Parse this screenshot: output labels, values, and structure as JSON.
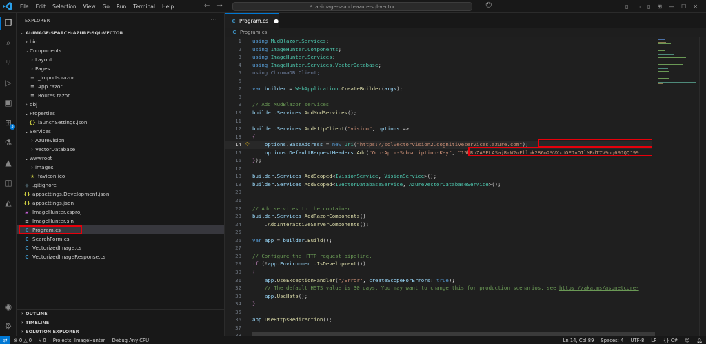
{
  "menu": [
    "File",
    "Edit",
    "Selection",
    "View",
    "Go",
    "Run",
    "Terminal",
    "Help"
  ],
  "search": {
    "text": "ai-image-search-azure-sql-vector"
  },
  "sidebar": {
    "title": "EXPLORER",
    "root": "AI-IMAGE-SEARCH-AZURE-SQL-VECTOR",
    "tree": [
      {
        "label": "bin",
        "type": "folder",
        "open": false,
        "depth": 1
      },
      {
        "label": "Components",
        "type": "folder",
        "open": true,
        "depth": 1
      },
      {
        "label": "Layout",
        "type": "folder",
        "open": false,
        "depth": 2
      },
      {
        "label": "Pages",
        "type": "folder",
        "open": false,
        "depth": 2
      },
      {
        "label": "_Imports.razor",
        "type": "razor",
        "depth": 2
      },
      {
        "label": "App.razor",
        "type": "razor",
        "depth": 2
      },
      {
        "label": "Routes.razor",
        "type": "razor",
        "depth": 2
      },
      {
        "label": "obj",
        "type": "folder",
        "open": false,
        "depth": 1
      },
      {
        "label": "Properties",
        "type": "folder",
        "open": true,
        "depth": 1
      },
      {
        "label": "launchSettings.json",
        "type": "json",
        "depth": 2
      },
      {
        "label": "Services",
        "type": "folder",
        "open": true,
        "depth": 1
      },
      {
        "label": "AzureVision",
        "type": "folder",
        "open": false,
        "depth": 2
      },
      {
        "label": "VectorDatabase",
        "type": "folder",
        "open": false,
        "depth": 2
      },
      {
        "label": "wwwroot",
        "type": "folder",
        "open": true,
        "depth": 1
      },
      {
        "label": "images",
        "type": "folder",
        "open": false,
        "depth": 2
      },
      {
        "label": "favicon.ico",
        "type": "ico",
        "depth": 2
      },
      {
        "label": ".gitignore",
        "type": "git",
        "depth": 1
      },
      {
        "label": "appsettings.Development.json",
        "type": "json",
        "depth": 1
      },
      {
        "label": "appsettings.json",
        "type": "json",
        "depth": 1
      },
      {
        "label": "ImageHunter.csproj",
        "type": "proj",
        "depth": 1
      },
      {
        "label": "ImageHunter.sln",
        "type": "sln",
        "depth": 1
      },
      {
        "label": "Program.cs",
        "type": "cs",
        "depth": 1,
        "selected": true
      },
      {
        "label": "SearchForm.cs",
        "type": "cs",
        "depth": 1
      },
      {
        "label": "VectorizedImage.cs",
        "type": "cs",
        "depth": 1
      },
      {
        "label": "VectorizedImageResponse.cs",
        "type": "cs",
        "depth": 1
      }
    ],
    "bottom_sections": [
      "OUTLINE",
      "TIMELINE",
      "SOLUTION EXPLORER"
    ]
  },
  "editor": {
    "tab_label": "Program.cs",
    "breadcrumb": "Program.cs",
    "current_line": 14,
    "lines": [
      [
        [
          "kw",
          "using "
        ],
        [
          "ns",
          "MudBlazor.Services"
        ],
        [
          "pl",
          ";"
        ]
      ],
      [
        [
          "kw",
          "using "
        ],
        [
          "ns",
          "ImageHunter.Components"
        ],
        [
          "pl",
          ";"
        ]
      ],
      [
        [
          "kw",
          "using "
        ],
        [
          "ns",
          "ImageHunter.Services"
        ],
        [
          "pl",
          ";"
        ]
      ],
      [
        [
          "kw",
          "using "
        ],
        [
          "ns",
          "ImageHunter.Services.VectorDatabase"
        ],
        [
          "pl",
          ";"
        ]
      ],
      [
        [
          "dim",
          "using ChromaDB.Client;"
        ]
      ],
      [],
      [
        [
          "kw",
          "var "
        ],
        [
          "id",
          "builder"
        ],
        [
          "pl",
          " = "
        ],
        [
          "cl",
          "WebApplication"
        ],
        [
          "pl",
          "."
        ],
        [
          "fn",
          "CreateBuilder"
        ],
        [
          "pl",
          "("
        ],
        [
          "id",
          "args"
        ],
        [
          "pl",
          ");"
        ]
      ],
      [],
      [
        [
          "cm",
          "// Add MudBlazor services"
        ]
      ],
      [
        [
          "id",
          "builder"
        ],
        [
          "pl",
          "."
        ],
        [
          "id",
          "Services"
        ],
        [
          "pl",
          "."
        ],
        [
          "fn",
          "AddMudServices"
        ],
        [
          "pl",
          "();"
        ]
      ],
      [],
      [
        [
          "id",
          "builder"
        ],
        [
          "pl",
          "."
        ],
        [
          "id",
          "Services"
        ],
        [
          "pl",
          "."
        ],
        [
          "fn",
          "AddHttpClient"
        ],
        [
          "pl",
          "("
        ],
        [
          "str",
          "\"vision\""
        ],
        [
          "pl",
          ", "
        ],
        [
          "id",
          "options"
        ],
        [
          "pl",
          " =>"
        ]
      ],
      [
        [
          "ctl",
          "{"
        ]
      ],
      [
        [
          "pl",
          "    "
        ],
        [
          "id",
          "options"
        ],
        [
          "pl",
          "."
        ],
        [
          "id",
          "BaseAddress"
        ],
        [
          "pl",
          " = "
        ],
        [
          "kw",
          "new "
        ],
        [
          "cl",
          "Uri"
        ],
        [
          "pl",
          "("
        ],
        [
          "str",
          "\"https://sqlvectorvision2.cognitiveservices.azure.com\""
        ],
        [
          "pl",
          ");"
        ]
      ],
      [
        [
          "pl",
          "    "
        ],
        [
          "id",
          "options"
        ],
        [
          "pl",
          "."
        ],
        [
          "id",
          "DefaultRequestHeaders"
        ],
        [
          "pl",
          "."
        ],
        [
          "fn",
          "Add"
        ],
        [
          "pl",
          "("
        ],
        [
          "str",
          "\"Ocp-Apim-Subscription-Key\""
        ],
        [
          "pl",
          ", "
        ],
        [
          "str",
          "\"15hRuZASELASajRrW2nFllok286m29VXxUOFJnO1lMRdT7V9og69JQQJ99"
        ]
      ],
      [
        [
          "ctl",
          "}"
        ],
        [
          "pl",
          ");"
        ]
      ],
      [],
      [
        [
          "id",
          "builder"
        ],
        [
          "pl",
          "."
        ],
        [
          "id",
          "Services"
        ],
        [
          "pl",
          "."
        ],
        [
          "fn",
          "AddScoped"
        ],
        [
          "pl",
          "<"
        ],
        [
          "cl",
          "IVisionService"
        ],
        [
          "pl",
          ", "
        ],
        [
          "cl",
          "VisionService"
        ],
        [
          "pl",
          ">();"
        ]
      ],
      [
        [
          "id",
          "builder"
        ],
        [
          "pl",
          "."
        ],
        [
          "id",
          "Services"
        ],
        [
          "pl",
          "."
        ],
        [
          "fn",
          "AddScoped"
        ],
        [
          "pl",
          "<"
        ],
        [
          "cl",
          "IVectorDatabaseService"
        ],
        [
          "pl",
          ", "
        ],
        [
          "cl",
          "AzureVectorDatabaseService"
        ],
        [
          "pl",
          ">();"
        ]
      ],
      [],
      [],
      [
        [
          "cm",
          "// Add services to the container."
        ]
      ],
      [
        [
          "id",
          "builder"
        ],
        [
          "pl",
          "."
        ],
        [
          "id",
          "Services"
        ],
        [
          "pl",
          "."
        ],
        [
          "fn",
          "AddRazorComponents"
        ],
        [
          "pl",
          "()"
        ]
      ],
      [
        [
          "pl",
          "    ."
        ],
        [
          "fn",
          "AddInteractiveServerComponents"
        ],
        [
          "pl",
          "();"
        ]
      ],
      [],
      [
        [
          "kw",
          "var "
        ],
        [
          "id",
          "app"
        ],
        [
          "pl",
          " = "
        ],
        [
          "id",
          "builder"
        ],
        [
          "pl",
          "."
        ],
        [
          "fn",
          "Build"
        ],
        [
          "pl",
          "();"
        ]
      ],
      [],
      [
        [
          "cm",
          "// Configure the HTTP request pipeline."
        ]
      ],
      [
        [
          "ctl",
          "if "
        ],
        [
          "pl",
          "(!"
        ],
        [
          "id",
          "app"
        ],
        [
          "pl",
          "."
        ],
        [
          "id",
          "Environment"
        ],
        [
          "pl",
          "."
        ],
        [
          "fn",
          "IsDevelopment"
        ],
        [
          "pl",
          "())"
        ]
      ],
      [
        [
          "ctl",
          "{"
        ]
      ],
      [
        [
          "pl",
          "    "
        ],
        [
          "id",
          "app"
        ],
        [
          "pl",
          "."
        ],
        [
          "fn",
          "UseExceptionHandler"
        ],
        [
          "pl",
          "("
        ],
        [
          "str",
          "\"/Error\""
        ],
        [
          "pl",
          ", "
        ],
        [
          "id",
          "createScopeForErrors"
        ],
        [
          "pl",
          ": "
        ],
        [
          "kw",
          "true"
        ],
        [
          "pl",
          ");"
        ]
      ],
      [
        [
          "pl",
          "    "
        ],
        [
          "cm",
          "// The default HSTS value is 30 days. You may want to change this for production scenarios, see "
        ],
        [
          "link",
          "https://aka.ms/aspnetcore-"
        ]
      ],
      [
        [
          "pl",
          "    "
        ],
        [
          "id",
          "app"
        ],
        [
          "pl",
          "."
        ],
        [
          "fn",
          "UseHsts"
        ],
        [
          "pl",
          "();"
        ]
      ],
      [
        [
          "ctl",
          "}"
        ]
      ],
      [],
      [
        [
          "id",
          "app"
        ],
        [
          "pl",
          "."
        ],
        [
          "fn",
          "UseHttpsRedirection"
        ],
        [
          "pl",
          "();"
        ]
      ],
      [],
      []
    ]
  },
  "colors": {
    "accent": "#0078d4",
    "highlight_box": "#e8000b"
  },
  "statusbar": {
    "errors": "0",
    "warnings": "0",
    "info": "0",
    "project": "Projects: ImageHunter",
    "config": "Debug Any CPU",
    "position": "Ln 14, Col 89",
    "spaces": "Spaces: 4",
    "encoding": "UTF-8",
    "eol": "LF",
    "language": "C#"
  }
}
